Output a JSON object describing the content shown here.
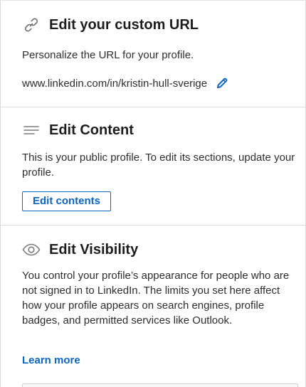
{
  "url_section": {
    "title": "Edit your custom URL",
    "icon": "link-icon",
    "description": "Personalize the URL for your profile.",
    "url": "www.linkedin.com/in/kristin-hull-sverige",
    "edit_icon": "pencil-icon"
  },
  "content_section": {
    "title": "Edit Content",
    "icon": "lines-icon",
    "description": "This is your public profile. To edit its sections, update your profile.",
    "button_label": "Edit contents"
  },
  "visibility_section": {
    "title": "Edit Visibility",
    "icon": "eye-icon",
    "description": "You control your profile’s appearance for people who are not signed in to LinkedIn. The limits you set here affect how your profile appears on search engines, profile badges, and permitted services like Outlook.",
    "link_label": "Learn more"
  },
  "colors": {
    "accent": "#0a66c2",
    "text": "#191919",
    "divider": "#dcdcdc"
  }
}
